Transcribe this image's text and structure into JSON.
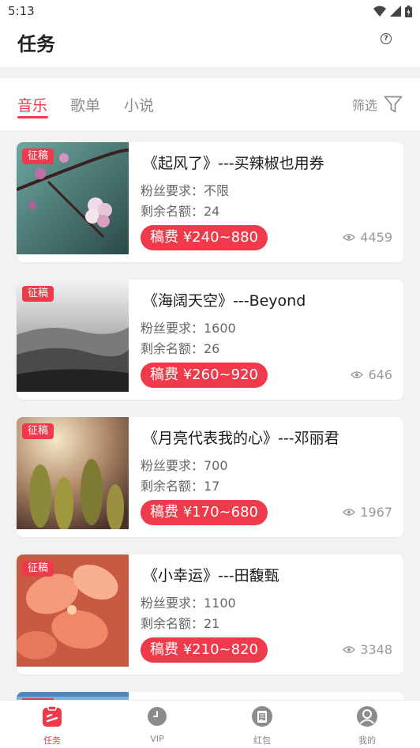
{
  "status": {
    "time": "5:13"
  },
  "header": {
    "title": "任务",
    "help_icon": "question-circle-icon"
  },
  "tabs": [
    {
      "label": "音乐",
      "active": true
    },
    {
      "label": "歌单",
      "active": false
    },
    {
      "label": "小说",
      "active": false
    }
  ],
  "filter": {
    "label": "筛选",
    "icon": "funnel-icon"
  },
  "cards": [
    {
      "badge": "征稿",
      "title": "《起风了》---买辣椒也用券",
      "fans": "粉丝要求：不限",
      "remaining": "剩余名额：24",
      "fee": "稿费 ¥240~880",
      "views": "4459"
    },
    {
      "badge": "征稿",
      "title": "《海阔天空》---Beyond",
      "fans": "粉丝要求：1600",
      "remaining": "剩余名额：26",
      "fee": "稿费 ¥260~920",
      "views": "646"
    },
    {
      "badge": "征稿",
      "title": "《月亮代表我的心》---邓丽君",
      "fans": "粉丝要求：700",
      "remaining": "剩余名额：17",
      "fee": "稿费 ¥170~680",
      "views": "1967"
    },
    {
      "badge": "征稿",
      "title": "《小幸运》---田馥甄",
      "fans": "粉丝要求：1100",
      "remaining": "剩余名额：21",
      "fee": "稿费 ¥210~820",
      "views": "3348"
    }
  ],
  "nav": [
    {
      "label": "任务",
      "icon": "task-icon",
      "active": true
    },
    {
      "label": "VIP",
      "icon": "vip-icon",
      "active": false
    },
    {
      "label": "红包",
      "icon": "red-packet-icon",
      "active": false
    },
    {
      "label": "我的",
      "icon": "profile-icon",
      "active": false
    }
  ],
  "colors": {
    "accent": "#ee3a4a",
    "background": "#f2f2f2"
  }
}
